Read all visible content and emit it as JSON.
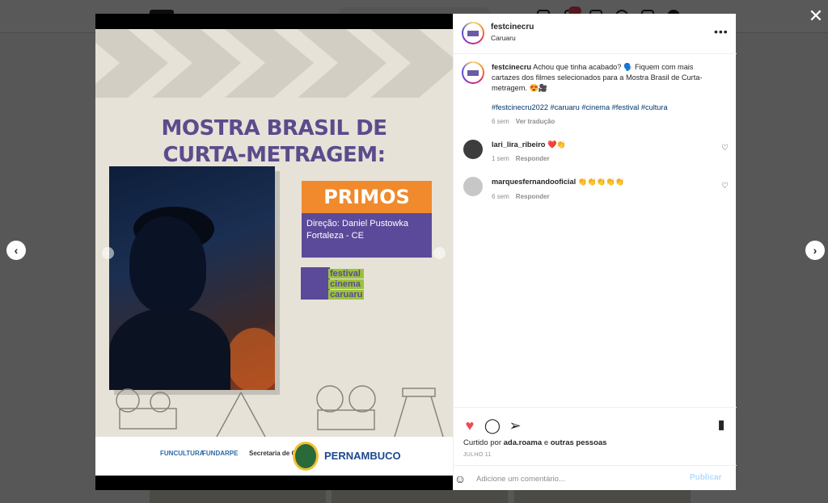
{
  "post": {
    "username": "festcinecru",
    "location": "Caruaru",
    "caption": "Achou que tinha acabado? 🗣️ Fiquem com mais cartazes dos filmes selecionados para a Mostra Brasil de Curta-metragem. 😍🎥",
    "hashtags": "#festcinecru2022 #caruaru #cinema #festival #cultura",
    "time": "6 sem",
    "translate_label": "Ver tradução"
  },
  "poster": {
    "title_line1": "MOSTRA BRASIL DE",
    "title_line2": "CURTA-METRAGEM:",
    "film": "PRIMOS",
    "director": "Direção: Daniel Pustowka",
    "city": "Fortaleza - CE",
    "festival_words": [
      "festival",
      "cinema",
      "caruaru"
    ],
    "sponsors": [
      "FUNCULTURA",
      "FUNDARPE",
      "Secretaria de Cultura"
    ],
    "state": "PERNAMBUCO"
  },
  "comments": [
    {
      "user": "lari_lira_ribeiro",
      "text": "❤️👏",
      "time": "1 sem",
      "reply": "Responder"
    },
    {
      "user": "marquesfernandooficial",
      "text": "👏👏👏👏👏",
      "time": "6 sem",
      "reply": "Responder"
    }
  ],
  "footer": {
    "liked_prefix": "Curtido por",
    "liked_user": "ada.roama",
    "liked_and": "e",
    "liked_others": "outras pessoas",
    "date": "JULHO 11",
    "comment_placeholder": "Adicione um comentário...",
    "publish_label": "Publicar"
  },
  "icons": {
    "close": "close-icon",
    "prev": "chevron-left-icon",
    "next": "chevron-right-icon",
    "more": "more-options-icon",
    "like": "heart-icon",
    "comment": "comment-icon",
    "share": "share-icon",
    "save": "bookmark-icon",
    "emoji": "emoji-icon"
  },
  "colors": {
    "like": "#ed4956",
    "link": "#00376b",
    "publish_disabled": "#b3dbff",
    "poster_purple": "#5b4a9a",
    "poster_orange": "#f08a2c"
  }
}
